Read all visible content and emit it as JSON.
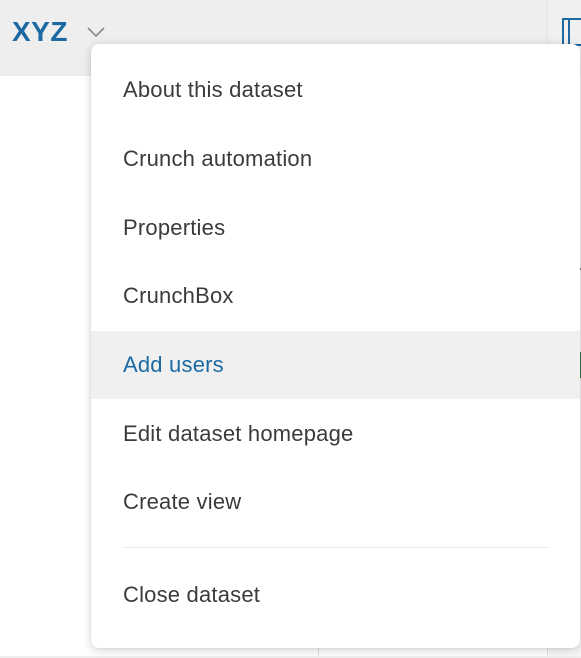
{
  "header": {
    "dataset_name": "XYZ"
  },
  "menu": {
    "items": [
      {
        "label": "About this dataset"
      },
      {
        "label": "Crunch automation"
      },
      {
        "label": "Properties"
      },
      {
        "label": "CrunchBox"
      },
      {
        "label": "Add users",
        "state": "hovered"
      },
      {
        "label": "Edit dataset homepage"
      },
      {
        "label": "Create view"
      }
    ],
    "footer_item": {
      "label": "Close dataset"
    }
  },
  "colors": {
    "accent": "#1c6aa3",
    "text": "#3b3b3b",
    "hover_bg": "#f0f0f0",
    "header_bg": "#eeeeee"
  }
}
